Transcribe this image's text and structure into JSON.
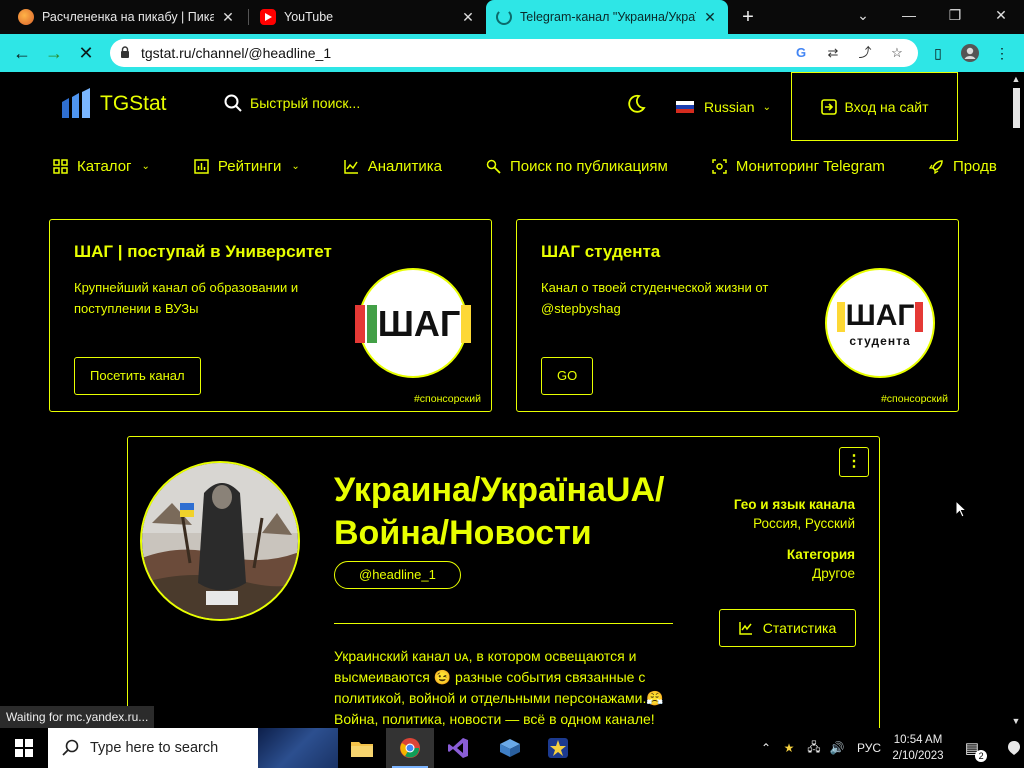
{
  "browser": {
    "tabs": [
      {
        "title": "Расчлененка на пикабу | Пикаб",
        "active": false
      },
      {
        "title": "YouTube",
        "active": false
      },
      {
        "title": "Telegram-канал \"Украина/Украї",
        "active": true
      }
    ],
    "new_tab": "+",
    "url": "tgstat.ru/channel/@headline_1",
    "accent": "#2ee6e6"
  },
  "site": {
    "logo": "TGStat",
    "search_placeholder": "Быстрый поиск...",
    "language": "Russian",
    "login": "Вход на сайт",
    "accent": "#e8ff00"
  },
  "menu": [
    {
      "label": "Каталог",
      "icon": "grid-icon",
      "dropdown": true
    },
    {
      "label": "Рейтинги",
      "icon": "bar-chart-icon",
      "dropdown": true
    },
    {
      "label": "Аналитика",
      "icon": "line-chart-icon",
      "dropdown": false
    },
    {
      "label": "Поиск по публикациям",
      "icon": "search-icon",
      "dropdown": false
    },
    {
      "label": "Мониторинг Telegram",
      "icon": "monitor-icon",
      "dropdown": false
    },
    {
      "label": "Продв",
      "icon": "rocket-icon",
      "dropdown": false
    }
  ],
  "promos": [
    {
      "title": "ШАГ | поступай в Университет",
      "desc": "Крупнейший канал об образовании и поступлении в ВУЗы",
      "button": "Посетить канал",
      "tag": "#спонсорский",
      "logo": "ШАГ",
      "logo_sub": ""
    },
    {
      "title": "ШАГ студента",
      "desc": "Канал о твоей студенческой жизни от @stepbyshag",
      "button": "GO",
      "tag": "#спонсорский",
      "logo": "ШАГ",
      "logo_sub": "студента"
    }
  ],
  "channel": {
    "title": "Украина/УкраїнаUA/ Война/Новости",
    "handle": "@headline_1",
    "description": "Украинский канал ᴜᴀ, в котором освещаются и высмеиваются 😉 разные события связанные с политикой, войной и отдельными персонажами.😤 Война, политика, новости — всё в одном канале!",
    "geo_label": "Гео и язык канала",
    "geo_value": "Россия, Русский",
    "category_label": "Категория",
    "category_value": "Другое",
    "stats_button": "Статистика"
  },
  "status": "Waiting for mc.yandex.ru...",
  "taskbar": {
    "search_placeholder": "Type here to search",
    "lang": "РУС",
    "time": "10:54 AM",
    "date": "2/10/2023",
    "notifications": "2"
  }
}
